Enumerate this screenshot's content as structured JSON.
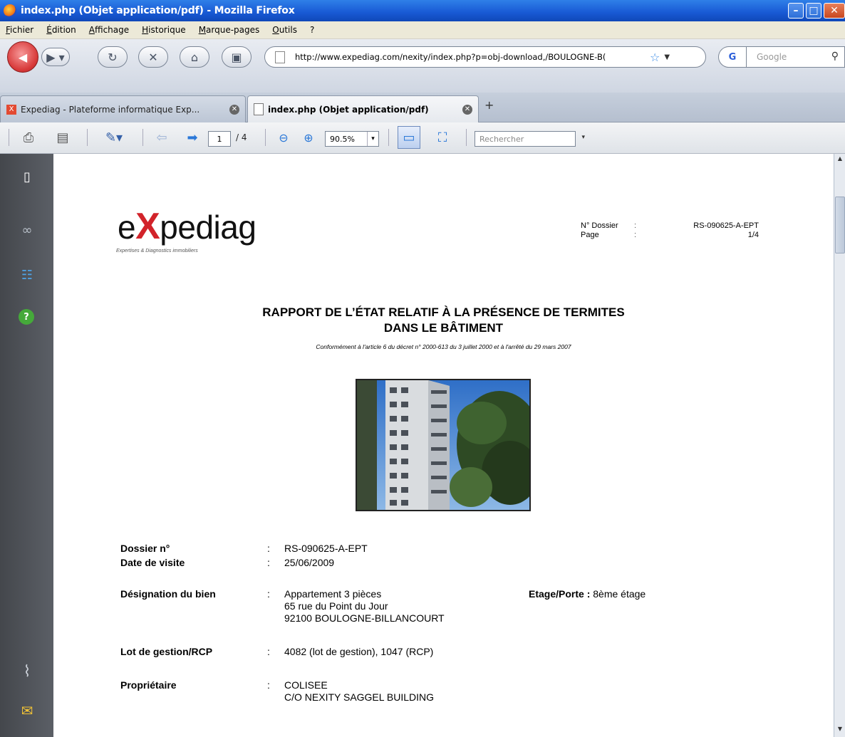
{
  "window": {
    "title": "index.php (Objet application/pdf) - Mozilla Firefox"
  },
  "menubar": {
    "items": [
      "Fichier",
      "Édition",
      "Affichage",
      "Historique",
      "Marque-pages",
      "Outils",
      "?"
    ]
  },
  "navbar": {
    "url": "http://www.expediag.com/nexity/index.php?p=obj-download,/BOULOGNE-B(",
    "search_engine": "G",
    "search_placeholder": "Google"
  },
  "tabs": [
    {
      "label": "Expediag - Plateforme informatique Exp...",
      "active": false
    },
    {
      "label": "index.php (Objet application/pdf)",
      "active": true
    }
  ],
  "pdf_toolbar": {
    "page_current": "1",
    "page_total": "/ 4",
    "zoom": "90.5%",
    "search_placeholder": "Rechercher"
  },
  "document": {
    "logo_text_pre": "e",
    "logo_text_x": "X",
    "logo_text_post": "pediag",
    "logo_tagline": "Expertises & Diagnostics immobiliers",
    "header": {
      "dossier_label": "N° Dossier",
      "page_label": "Page",
      "colon1": ":",
      "colon2": ":",
      "dossier_value": "RS-090625-A-EPT",
      "page_value": "1/4"
    },
    "title_line1": "RAPPORT DE L’ÉTAT RELATIF À LA PRÉSENCE DE TERMITES",
    "title_line2": "DANS LE BÂTIMENT",
    "subtitle": "Conformément à l'article 6 du décret n° 2000-613 du 3 juillet 2000 et à l'arrêté du 29 mars 2007",
    "fields": {
      "dossier_label": "Dossier n°",
      "dossier_value": "RS-090625-A-EPT",
      "date_label": "Date de visite",
      "date_value": "25/06/2009",
      "designation_label": "Désignation du bien",
      "designation_line1": "Appartement 3 pièces",
      "designation_line2": "65 rue du Point du Jour",
      "designation_line3": "92100 BOULOGNE-BILLANCOURT",
      "etage_label": "Etage/Porte :",
      "etage_value": "8ème étage",
      "lot_label": "Lot de gestion/RCP",
      "lot_value": "4082 (lot de gestion), 1047 (RCP)",
      "proprietaire_label": "Propriétaire",
      "proprietaire_line1": "COLISEE",
      "proprietaire_line2": "C/O NEXITY SAGGEL BUILDING",
      "colon": ":"
    }
  }
}
